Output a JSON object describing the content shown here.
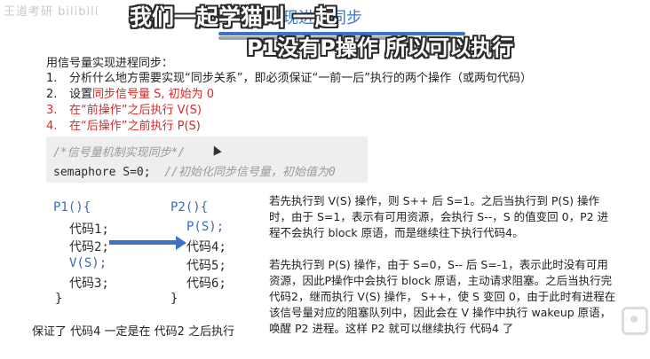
{
  "watermark": "王道考研 bilibili",
  "slide": {
    "title_visible": "实现进程同步"
  },
  "captions": {
    "line1": "我们一起学猫叫 一起",
    "line2": "P1没有P操作 所以可以执行"
  },
  "steps": {
    "title": "用信号量实现进程同步：",
    "items": [
      {
        "num": "1.",
        "text": "分析什么地方需要实现“同步关系”，即必须保证“一前一后”执行的两个操作（或两句代码）"
      },
      {
        "num": "2.",
        "text_prefix": "设置",
        "text_red": "同步信号量 S, 初始为 0",
        "text_suffix": ""
      },
      {
        "num": "3.",
        "text": "在“前操作”之后执行 V(S)"
      },
      {
        "num": "4.",
        "text": "在“后操作”之前执行 P(S)"
      }
    ]
  },
  "code_box": {
    "comment": "/*信号量机制实现同步*/",
    "line": "semaphore S=0;",
    "line_comment": "//初始化同步信号量，初始值为0"
  },
  "p1": {
    "header": "P1(){",
    "lines": [
      "代码1;",
      "代码2;",
      "V(S);",
      "代码3;"
    ],
    "close": "}"
  },
  "p2": {
    "header": "P2(){",
    "lines": [
      "P(S);",
      "代码4;",
      "代码5;",
      "代码6;"
    ],
    "close": "}"
  },
  "guarantee": "保证了 代码4 一定是在 代码2 之后执行",
  "explanations": {
    "para1": "若先执行到 V(S) 操作，则 S++ 后 S=1。之后当执行到 P(S) 操作时，由于 S=1，表示有可用资源，会执行 S--，S 的值变回 0，P2 进程不会执行 block 原语，而是继续往下执行代码4。",
    "para2": "若先执行到 P(S) 操作，由于 S=0，S-- 后 S=-1，表示此时没有可用资源，因此P操作中会执行 block 原语，主动请求阻塞。之后当执行完代码2，继而执行 V(S) 操作， S++，使 S 变回 0，由于此时有进程在该信号量对应的阻塞队列中，因此会在 V 操作中执行 wakeup 原语，唤醒 P2 进程。这样 P2 就可以继续执行 代码4 了"
  },
  "colors": {
    "accent_blue": "#3b74c6",
    "red": "#d42a2a"
  }
}
